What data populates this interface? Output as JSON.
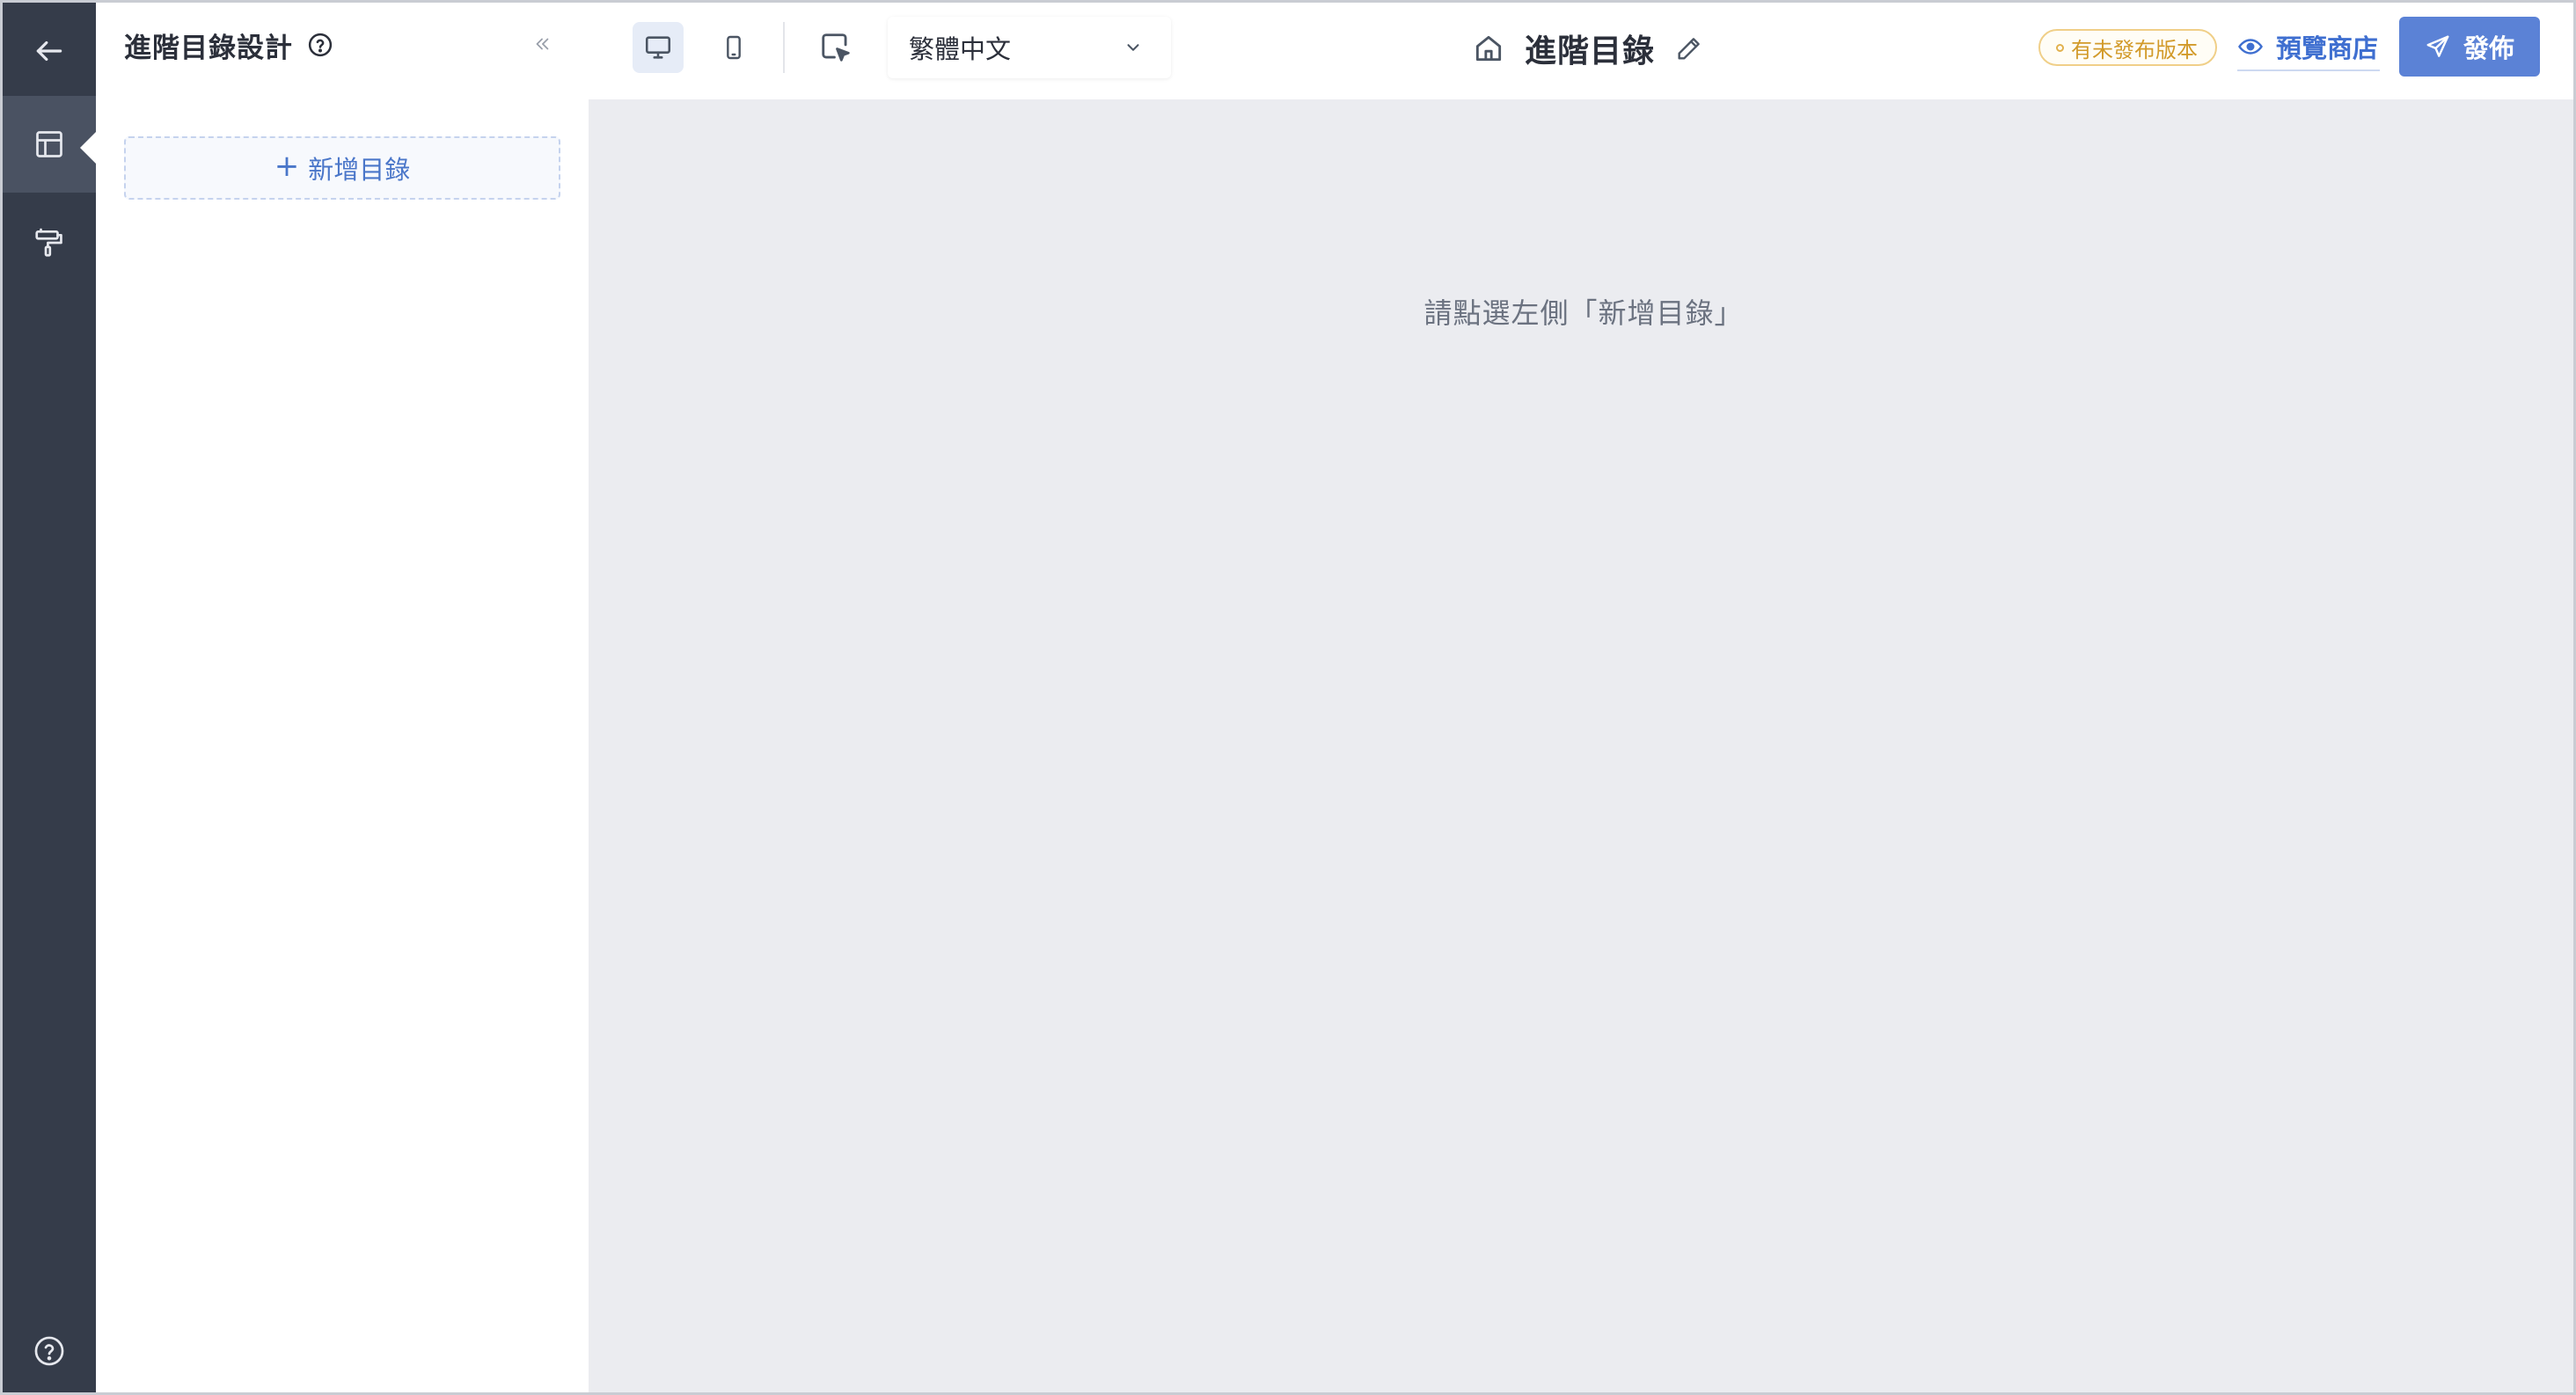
{
  "rail": {
    "items": [
      {
        "name": "back",
        "icon": "arrow-left-icon"
      },
      {
        "name": "layout",
        "icon": "layout-icon",
        "active": true
      },
      {
        "name": "theme",
        "icon": "paint-roller-icon"
      },
      {
        "name": "help",
        "icon": "help-circle-icon"
      }
    ]
  },
  "panel": {
    "title": "進階目錄設計",
    "add_button": "新增目錄"
  },
  "topbar": {
    "language": "繁體中文",
    "page_title": "進階目錄",
    "unpublished_badge": "有未發布版本",
    "preview_label": "預覽商店",
    "publish_label": "發佈"
  },
  "canvas": {
    "hint": "請點選左側「新增目錄」"
  },
  "colors": {
    "rail_bg": "#353c4a",
    "accent": "#5b82d6",
    "badge": "#d29a2a",
    "canvas_bg": "#ebecf0"
  }
}
